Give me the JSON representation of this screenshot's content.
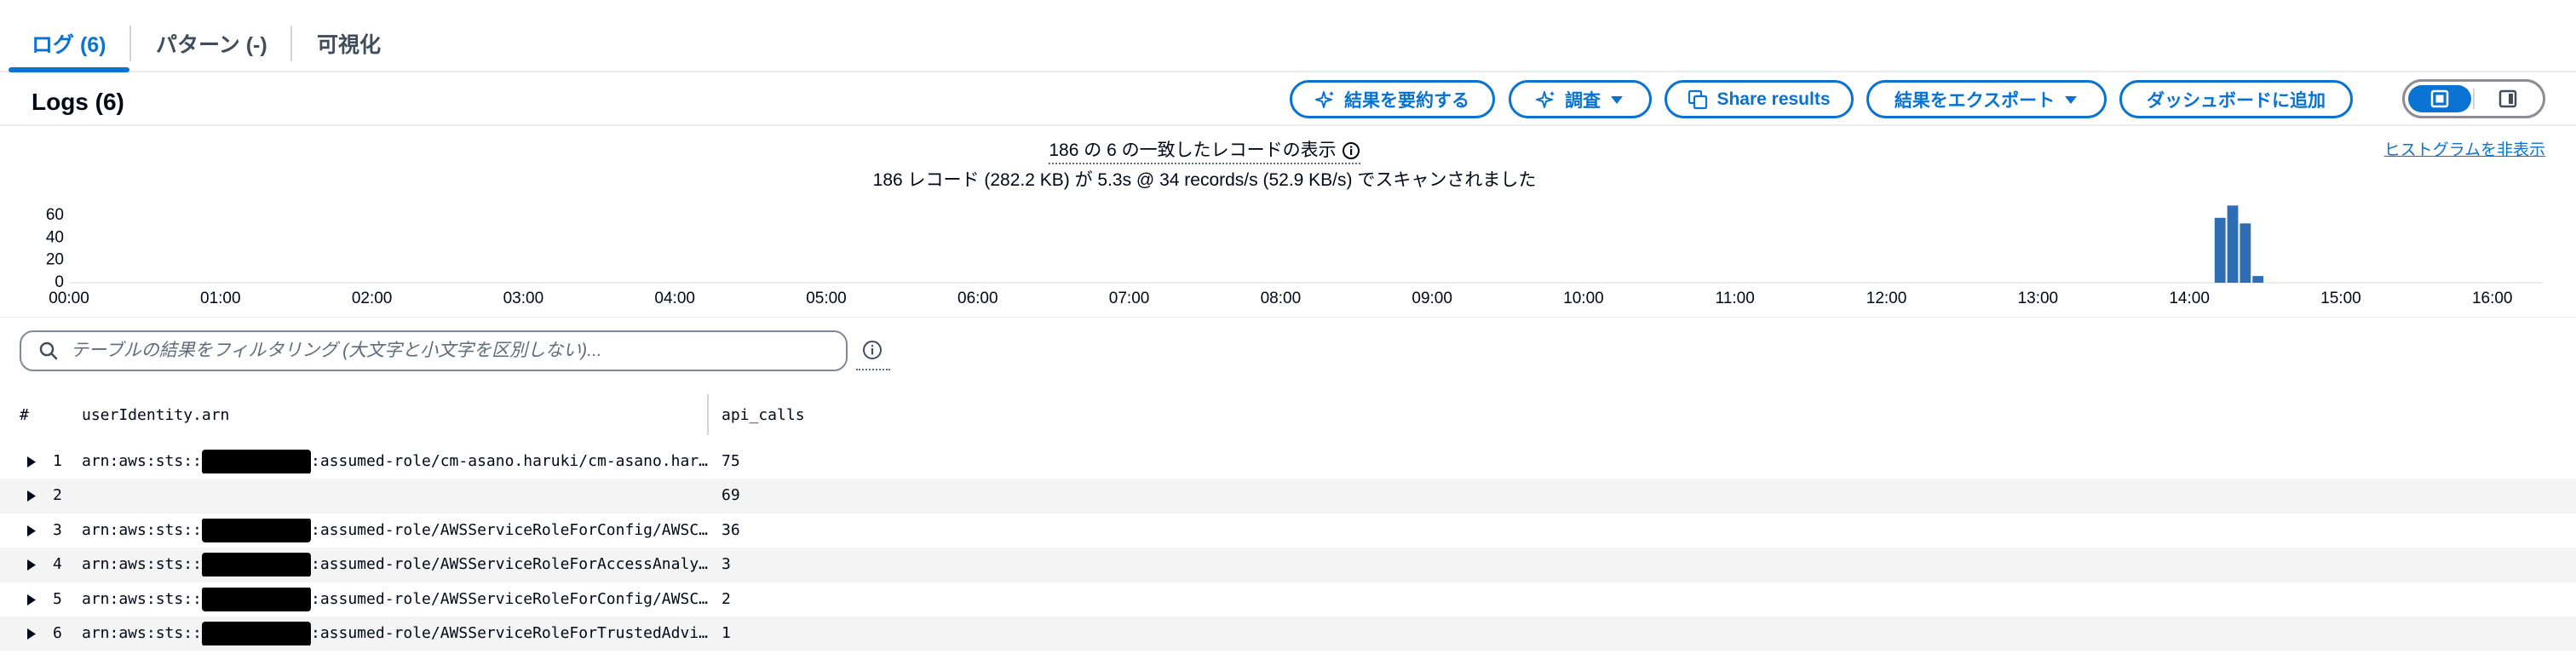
{
  "tabs": [
    {
      "label": "ログ (6)",
      "active": true
    },
    {
      "label": "パターン (-)",
      "active": false
    },
    {
      "label": "可視化",
      "active": false
    }
  ],
  "header": {
    "title": "Logs (6)"
  },
  "toolbar": {
    "summarize_label": "結果を要約する",
    "investigate_label": "調査",
    "share_label": "Share results",
    "export_label": "結果をエクスポート",
    "dashboard_label": "ダッシュボードに追加",
    "view_toggle": {
      "selected": "bottom-panel-icon",
      "options": [
        "bottom-panel-icon",
        "side-panel-icon"
      ]
    }
  },
  "summary": {
    "matched_text": "186 の 6 の一致したレコードの表示",
    "scanned_text": "186 レコード (282.2 KB) が 5.3s @ 34 records/s (52.9 KB/s) でスキャンされました",
    "hide_histogram_link": "ヒストグラムを非表示"
  },
  "filter": {
    "placeholder": "テーブルの結果をフィルタリング (大文字と小文字を区別しない)...",
    "value": ""
  },
  "table": {
    "columns": [
      "#",
      "userIdentity.arn",
      "api_calls"
    ],
    "rows": [
      {
        "index": "1",
        "arn_prefix": "arn:aws:sts::",
        "redacted": true,
        "arn_suffix": ":assumed-role/cm-asano.haruki/cm-asano.har…",
        "api_calls": "75"
      },
      {
        "index": "2",
        "arn_prefix": "",
        "redacted": false,
        "arn_suffix": "",
        "api_calls": "69"
      },
      {
        "index": "3",
        "arn_prefix": "arn:aws:sts::",
        "redacted": true,
        "arn_suffix": ":assumed-role/AWSServiceRoleForConfig/AWSC…",
        "api_calls": "36"
      },
      {
        "index": "4",
        "arn_prefix": "arn:aws:sts::",
        "redacted": true,
        "arn_suffix": ":assumed-role/AWSServiceRoleForAccessAnaly…",
        "api_calls": "3"
      },
      {
        "index": "5",
        "arn_prefix": "arn:aws:sts::",
        "redacted": true,
        "arn_suffix": ":assumed-role/AWSServiceRoleForConfig/AWSC…",
        "api_calls": "2"
      },
      {
        "index": "6",
        "arn_prefix": "arn:aws:sts::",
        "redacted": true,
        "arn_suffix": ":assumed-role/AWSServiceRoleForTrustedAdvi…",
        "api_calls": "1"
      }
    ]
  },
  "icons": {
    "summarize": "sparkle-icon",
    "investigate": "sparkle-icon",
    "share": "copy-icon",
    "dropdown": "caret-down-icon",
    "search": "search-icon",
    "info": "info-icon",
    "row_expand": "caret-right-icon"
  },
  "colors": {
    "accent": "#0972d3",
    "text": "#000716",
    "bar": "#2f6db5",
    "redaction": "#000000",
    "row_alt": "#f4f4f4"
  },
  "chart_data": {
    "type": "bar",
    "x": [
      "14:10",
      "14:15",
      "14:20",
      "14:25"
    ],
    "values": [
      58,
      69,
      53,
      6
    ],
    "x_ticks": [
      "00:00",
      "01:00",
      "02:00",
      "03:00",
      "04:00",
      "05:00",
      "06:00",
      "07:00",
      "08:00",
      "09:00",
      "10:00",
      "11:00",
      "12:00",
      "13:00",
      "14:00",
      "15:00",
      "16:00"
    ],
    "y_ticks": [
      60,
      40,
      20,
      0
    ],
    "xlim": [
      "00:00",
      "16:20"
    ],
    "ylim": [
      0,
      70
    ],
    "grid": false
  }
}
